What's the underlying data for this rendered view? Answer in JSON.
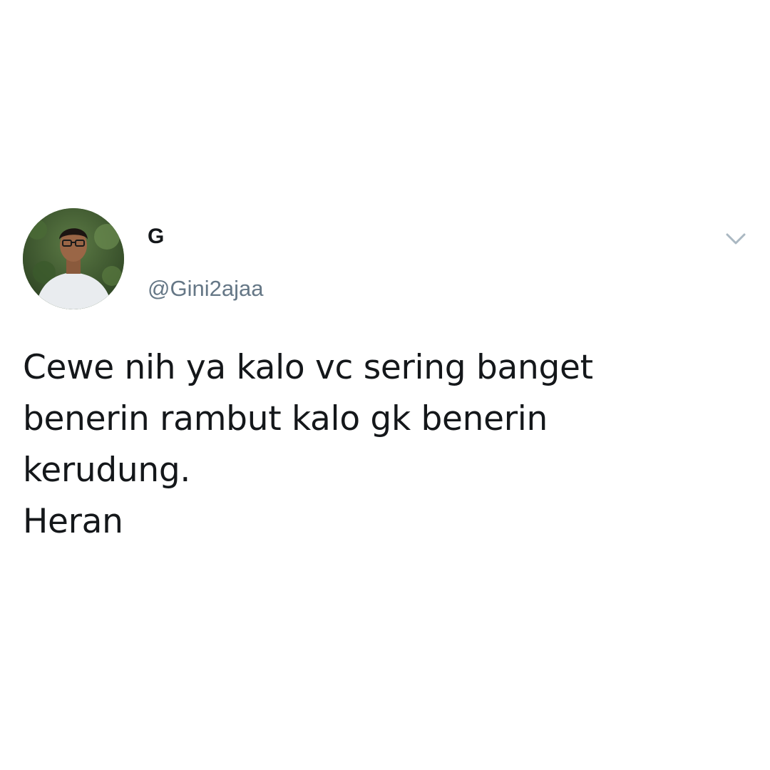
{
  "theme": {
    "background": "#ffffff",
    "text_primary": "#14171a",
    "text_secondary": "#657786",
    "chevron_color": "#aab8c2"
  },
  "tweet": {
    "author": {
      "display_name": "G",
      "handle": "@Gini2ajaa",
      "avatar_icon": "user-photo-avatar"
    },
    "menu_icon": "chevron-down-icon",
    "text_lines": [
      "Cewe nih ya kalo vc sering banget",
      "benerin rambut kalo gk benerin",
      "kerudung.",
      "Heran"
    ]
  }
}
